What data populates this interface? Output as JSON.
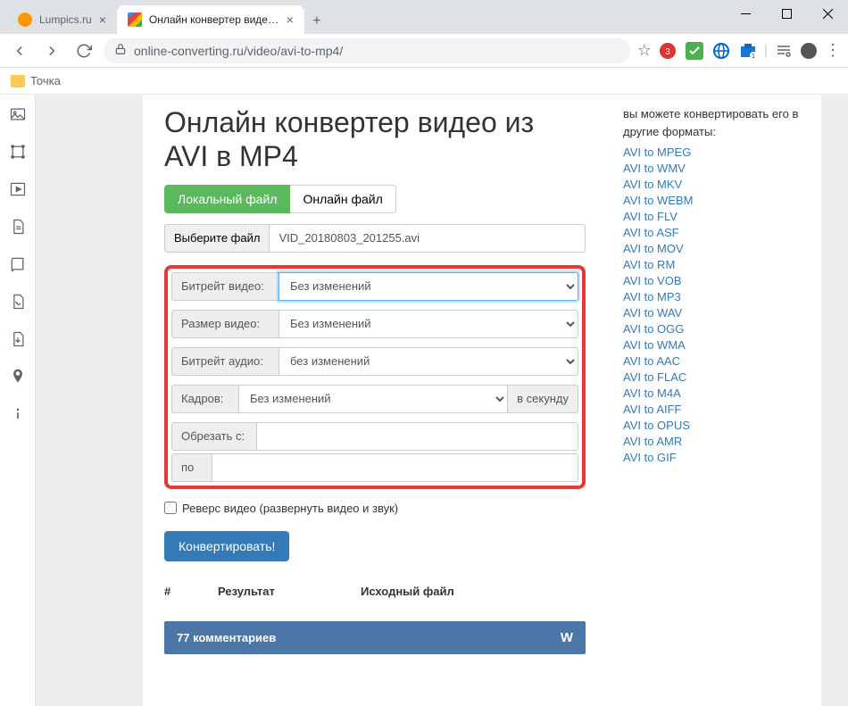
{
  "tabs": [
    {
      "title": "Lumpics.ru"
    },
    {
      "title": "Онлайн конвертер видео из AV"
    }
  ],
  "url": "online-converting.ru/video/avi-to-mp4/",
  "bookmark": "Точка",
  "page": {
    "h1": "Онлайн конвертер видео из AVI в MP4",
    "tab_local": "Локальный файл",
    "tab_online": "Онлайн файл",
    "file_btn": "Выберите файл",
    "file_name": "VID_20180803_201255.avi",
    "fields": {
      "bitrate_video_label": "Битрейт видео:",
      "bitrate_video_value": "Без изменений",
      "size_video_label": "Размер видео:",
      "size_video_value": "Без изменений",
      "bitrate_audio_label": "Битрейт аудио:",
      "bitrate_audio_value": "без изменений",
      "frames_label": "Кадров:",
      "frames_value": "Без изменений",
      "frames_suffix": "в секунду",
      "cut_from_label": "Обрезать с:",
      "cut_to_label": "по"
    },
    "reverse_label": "Реверс видео (развернуть видео и звук)",
    "convert_btn": "Конвертировать!",
    "results": {
      "col1": "#",
      "col2": "Результат",
      "col3": "Исходный файл"
    },
    "comments_count": "77 комментариев"
  },
  "sidebar_right": {
    "intro": "вы можете конвертировать его в другие форматы:",
    "links": [
      "AVI to MPEG",
      "AVI to WMV",
      "AVI to MKV",
      "AVI to WEBM",
      "AVI to FLV",
      "AVI to ASF",
      "AVI to MOV",
      "AVI to RM",
      "AVI to VOB",
      "AVI to MP3",
      "AVI to WAV",
      "AVI to OGG",
      "AVI to WMA",
      "AVI to AAC",
      "AVI to FLAC",
      "AVI to M4A",
      "AVI to AIFF",
      "AVI to OPUS",
      "AVI to AMR",
      "AVI to GIF"
    ]
  }
}
